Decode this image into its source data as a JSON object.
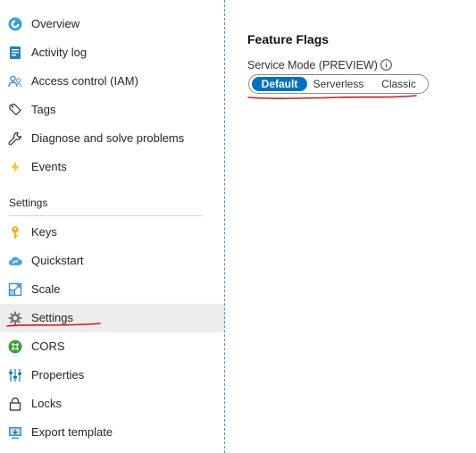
{
  "sidebar": {
    "items": [
      {
        "label": "Overview",
        "icon": "overview-icon"
      },
      {
        "label": "Activity log",
        "icon": "activity-log-icon"
      },
      {
        "label": "Access control (IAM)",
        "icon": "access-control-icon"
      },
      {
        "label": "Tags",
        "icon": "tag-icon"
      },
      {
        "label": "Diagnose and solve problems",
        "icon": "wrench-icon"
      },
      {
        "label": "Events",
        "icon": "lightning-icon"
      }
    ],
    "section_heading": "Settings",
    "settings_items": [
      {
        "label": "Keys",
        "icon": "key-icon"
      },
      {
        "label": "Quickstart",
        "icon": "cloud-quickstart-icon"
      },
      {
        "label": "Scale",
        "icon": "scale-icon"
      },
      {
        "label": "Settings",
        "icon": "gear-icon",
        "selected": true
      },
      {
        "label": "CORS",
        "icon": "cors-icon"
      },
      {
        "label": "Properties",
        "icon": "properties-icon"
      },
      {
        "label": "Locks",
        "icon": "lock-icon"
      },
      {
        "label": "Export template",
        "icon": "export-template-icon"
      }
    ]
  },
  "main": {
    "title": "Feature Flags",
    "service_mode": {
      "label": "Service Mode (PREVIEW)",
      "options": [
        "Default",
        "Serverless",
        "Classic"
      ],
      "selected": "Default"
    }
  },
  "colors": {
    "accent": "#0072c6",
    "selected_row": "#ededed",
    "annotation": "#d11a1a",
    "splitter": "#3a9ad9"
  }
}
